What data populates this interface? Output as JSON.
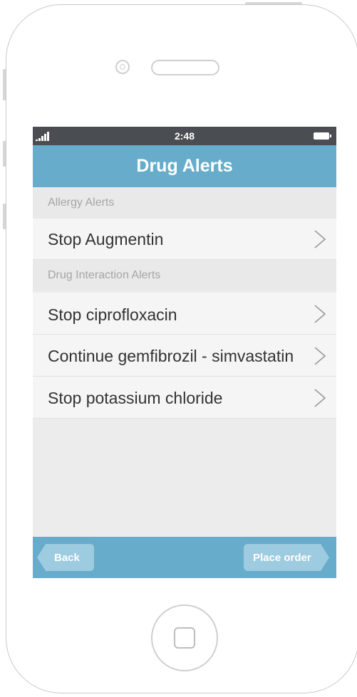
{
  "status_bar": {
    "time": "2:48",
    "icons": [
      "signal-icon",
      "battery-icon"
    ]
  },
  "nav": {
    "title": "Drug Alerts"
  },
  "sections": [
    {
      "header": "Allergy Alerts",
      "items": [
        {
          "label": "Stop Augmentin",
          "icon": "chevron-right-icon"
        }
      ]
    },
    {
      "header": "Drug Interaction Alerts",
      "items": [
        {
          "label": "Stop ciprofloxacin",
          "icon": "chevron-right-icon"
        },
        {
          "label": "Continue gemfibrozil - simvastatin",
          "icon": "chevron-right-icon"
        },
        {
          "label": "Stop potassium chloride",
          "icon": "chevron-right-icon"
        }
      ]
    }
  ],
  "toolbar": {
    "back_label": "Back",
    "order_label": "Place order"
  },
  "colors": {
    "accent": "#67acca",
    "status_bar": "#4a4d52",
    "button": "#9dcbdf",
    "list_background": "#ececec"
  }
}
